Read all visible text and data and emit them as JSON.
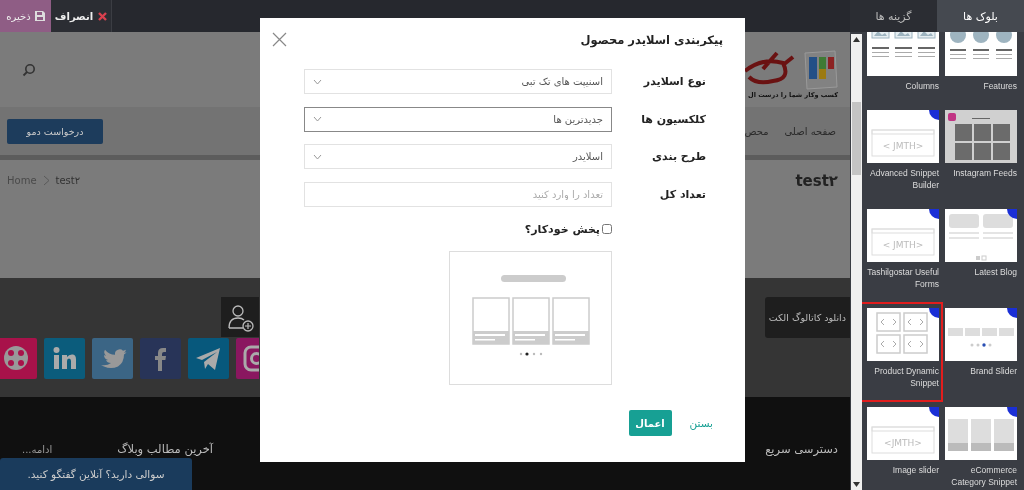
{
  "top_bar": {
    "save": "ذخیره",
    "discard": "انصراف"
  },
  "site": {
    "tagline": "کسب وکار شما را درست ال",
    "demo_button": "درخواست دمو",
    "nav": [
      "صفحه اصلی",
      "محص"
    ],
    "breadcrumb": [
      "test۲",
      "Home"
    ],
    "page_title": "test۲",
    "catalog": "دانلود کاتالوگ الکت",
    "social": [
      {
        "kind": "aparat",
        "color": "#a8124a"
      },
      {
        "kind": "linkedin",
        "color": "#0b5c7c"
      },
      {
        "kind": "twitter",
        "color": "#3b6585"
      },
      {
        "kind": "facebook",
        "color": "#283458"
      },
      {
        "kind": "telegram",
        "color": "#07587c"
      },
      {
        "kind": "instagram",
        "color": "#8a1760"
      }
    ],
    "footer": {
      "more": "ادامه...",
      "blog": "آخرین مطالب وبلاگ",
      "quick": "دسترسی سریع"
    },
    "chat": "سوالی دارید؟ آنلاین گفتگو کنید."
  },
  "dialog": {
    "title": "پیکربندی اسلایدر محصول",
    "fields": [
      {
        "label": "نوع اسلایدر",
        "kind": "select",
        "value": "اسنیپت های تک تبی",
        "focused": false
      },
      {
        "label": "کلکسیون ها",
        "kind": "select",
        "value": "جدیدترین ها",
        "focused": true
      },
      {
        "label": "طرح بندی",
        "kind": "select",
        "value": "اسلایدر",
        "focused": false
      },
      {
        "label": "تعداد کل",
        "kind": "input",
        "placeholder": "تعداد را وارد کنید",
        "focused": false
      }
    ],
    "autoplay": {
      "label": "پخش خودکار؟",
      "checked": false
    },
    "apply": "اعمال",
    "close": "بستن"
  },
  "panel": {
    "tabs": [
      {
        "label": "بلوک ها",
        "selected": true
      },
      {
        "label": "گزینه ها",
        "selected": false
      }
    ],
    "snippets": [
      {
        "name": "Features",
        "kind": "features",
        "new": false,
        "highlighted": false
      },
      {
        "name": "Instagram Feeds",
        "kind": "instagram",
        "new": false,
        "highlighted": false
      },
      {
        "name": "Latest Blog",
        "kind": "blog",
        "new": true,
        "highlighted": false
      },
      {
        "name": "Brand Slider",
        "kind": "brands",
        "new": true,
        "highlighted": false
      },
      {
        "name": "eCommerce Category Snippet",
        "kind": "categories",
        "new": true,
        "highlighted": false
      },
      {
        "name": "Columns",
        "kind": "columns",
        "new": false,
        "highlighted": false
      },
      {
        "name": "Advanced Snippet Builder",
        "kind": "code",
        "preview_text": "<JMTH >",
        "new": true,
        "highlighted": false
      },
      {
        "name": "Tashilgostar Useful Forms",
        "kind": "code",
        "preview_text": "<JMTH >",
        "new": true,
        "highlighted": false
      },
      {
        "name": "Product Dynamic Snippet",
        "kind": "products",
        "new": true,
        "highlighted": true
      },
      {
        "name": "Image slider",
        "kind": "code",
        "preview_text": "<JMTH>",
        "new": true,
        "highlighted": false
      }
    ]
  }
}
